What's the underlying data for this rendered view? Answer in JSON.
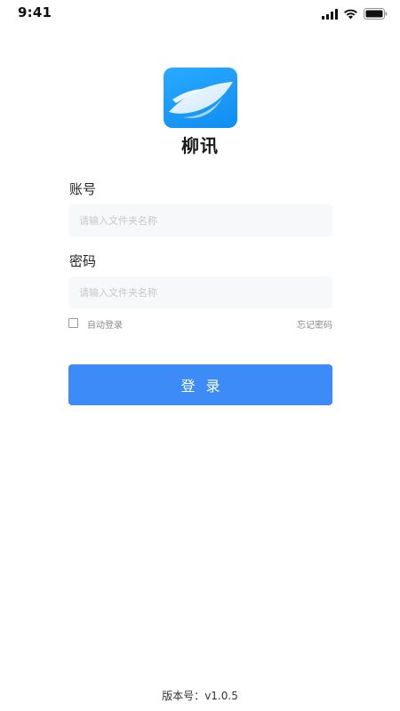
{
  "status_bar": {
    "time": "9:41"
  },
  "app": {
    "name": "柳讯"
  },
  "form": {
    "account": {
      "label": "账号",
      "placeholder": "请输入文件夹名称",
      "value": ""
    },
    "password": {
      "label": "密码",
      "placeholder": "请输入文件夹名称",
      "value": ""
    },
    "auto_login": {
      "label": "自动登录",
      "checked": false
    },
    "forgot_password": "忘记密码",
    "submit_label": "登录"
  },
  "footer": {
    "version_label": "版本号：",
    "version_value": "v1.0.5"
  },
  "colors": {
    "primary": "#3d8bf7",
    "logo_bg": "#1a9cf8",
    "input_bg": "#f7f8fa"
  },
  "icons": [
    "signal-icon",
    "wifi-icon",
    "battery-icon",
    "bird-logo-icon"
  ]
}
